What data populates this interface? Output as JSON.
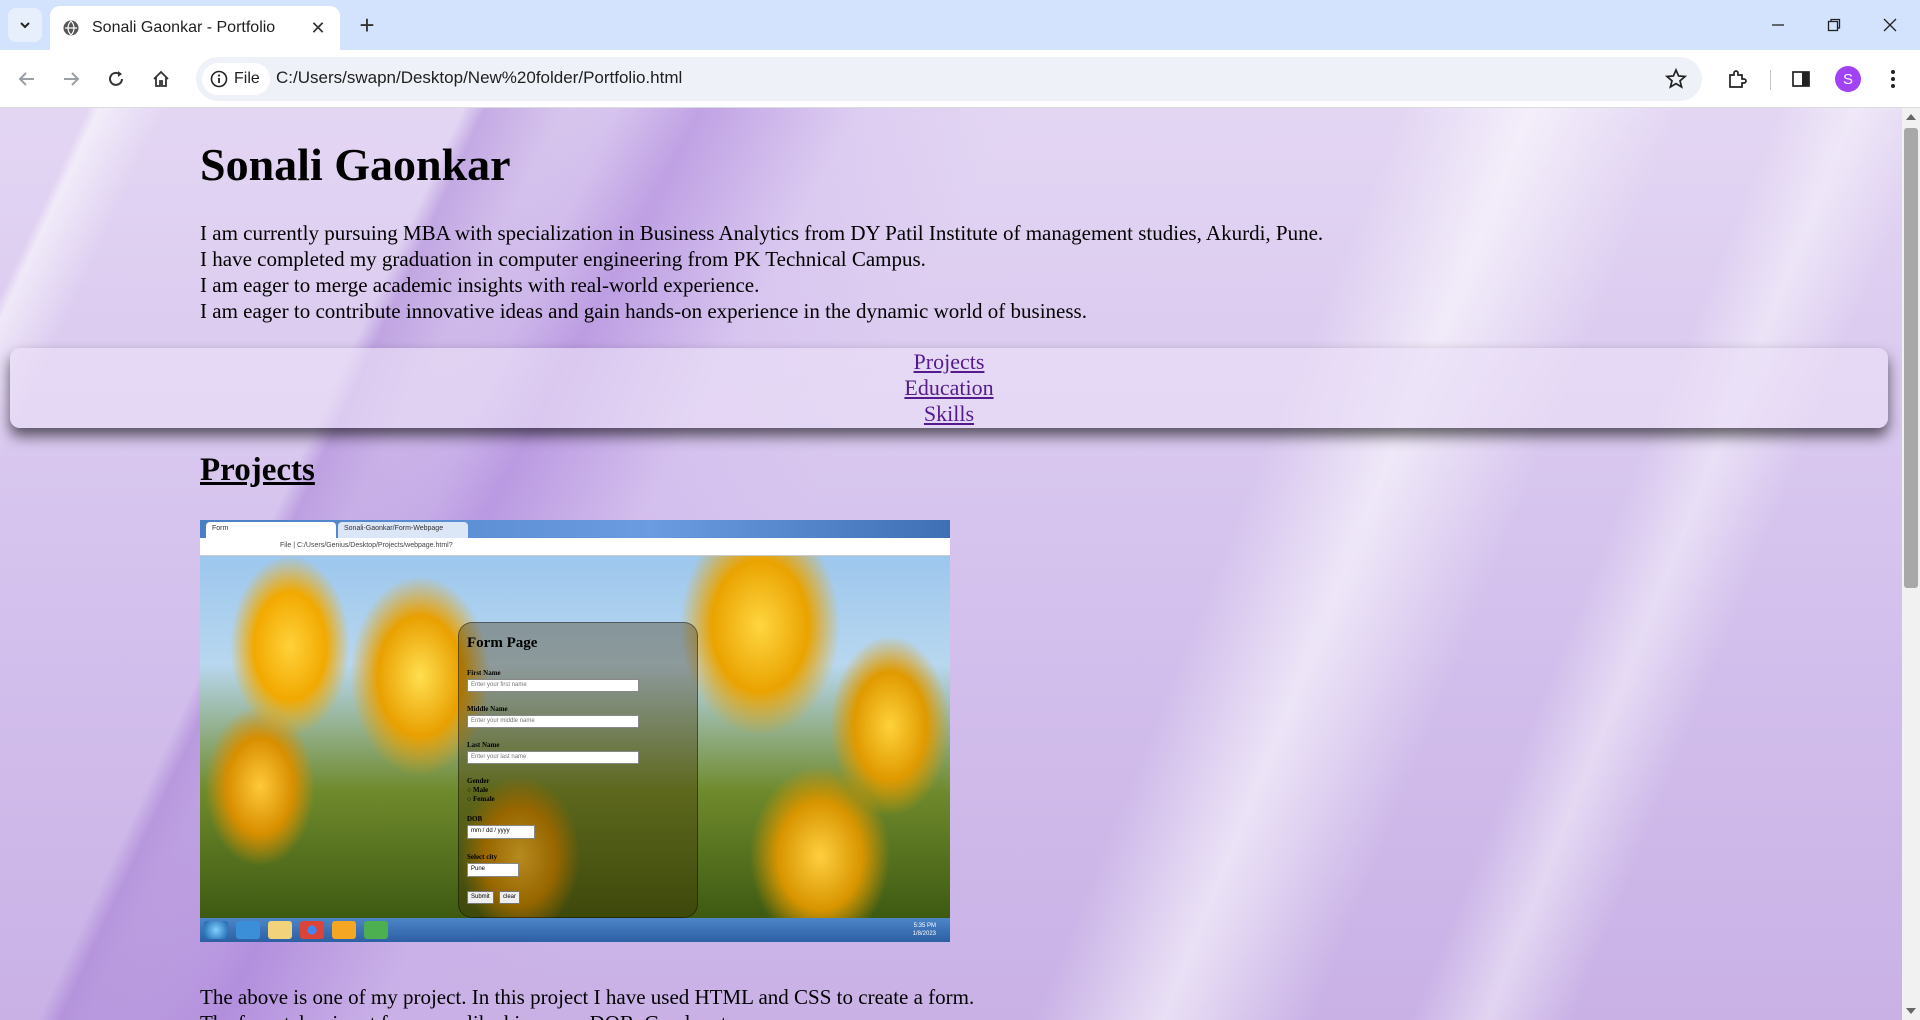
{
  "browser": {
    "tab_title": "Sonali Gaonkar - Portfolio",
    "site_chip": "File",
    "url": "C:/Users/swapn/Desktop/New%20folder/Portfolio.html",
    "profile_initial": "S"
  },
  "page": {
    "name": "Sonali Gaonkar",
    "bio": [
      "I am currently pursuing MBA with specialization in Business Analytics from DY Patil Institute of management studies, Akurdi, Pune.",
      "I have completed my graduation in computer engineering from PK Technical Campus.",
      "I am eager to merge academic insights with real-world experience.",
      "I am eager to contribute innovative ideas and gain hands-on experience in the dynamic world of business."
    ],
    "nav": [
      "Projects",
      "Education",
      "Skills"
    ],
    "section_title": "Projects",
    "project_description": [
      "The above is one of my project. In this project I have used HTML and CSS to create a form.",
      "The form takes input from user like his name, DOB, Gender etc."
    ]
  },
  "project_shot": {
    "tab1": "Form",
    "tab2": "Sonali-Gaonkar/Form-Webpage",
    "url": "File  |  C:/Users/Genius/Desktop/Projects/webpage.html?",
    "form_title": "Form Page",
    "first_name_label": "First Name",
    "first_name_placeholder": "Enter your first name",
    "middle_name_label": "Middle Name",
    "middle_name_placeholder": "Enter your middle name",
    "last_name_label": "Last Name",
    "last_name_placeholder": "Enter your last name",
    "gender_label": "Gender",
    "male": "Male",
    "female": "Female",
    "dob_label": "DOB",
    "dob_value": "mm / dd / yyyy",
    "city_label": "Select city",
    "city_value": "Pune",
    "submit": "Submit",
    "clear": "clear",
    "clock_time": "5:35 PM",
    "clock_date": "1/8/2023"
  }
}
